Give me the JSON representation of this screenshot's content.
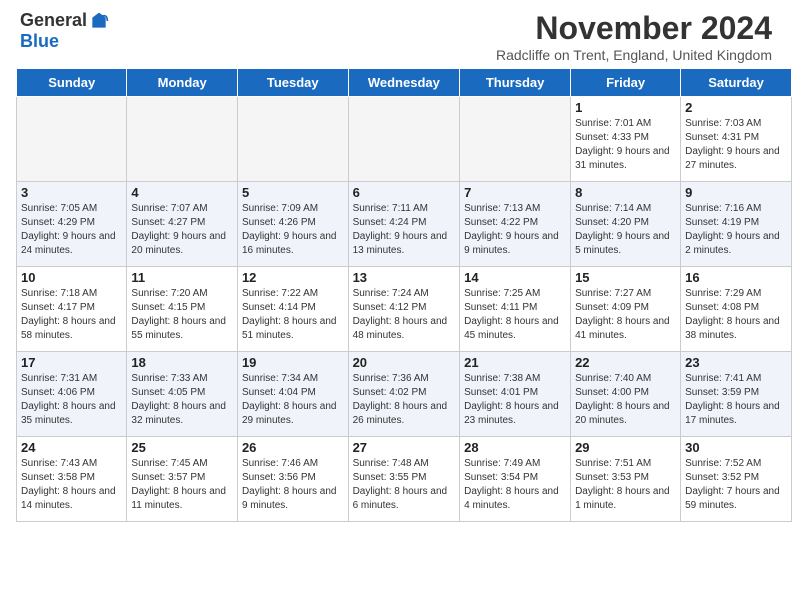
{
  "header": {
    "logo": {
      "general": "General",
      "blue": "Blue"
    },
    "title": "November 2024",
    "subtitle": "Radcliffe on Trent, England, United Kingdom"
  },
  "calendar": {
    "days_of_week": [
      "Sunday",
      "Monday",
      "Tuesday",
      "Wednesday",
      "Thursday",
      "Friday",
      "Saturday"
    ],
    "weeks": [
      [
        {
          "day": "",
          "info": ""
        },
        {
          "day": "",
          "info": ""
        },
        {
          "day": "",
          "info": ""
        },
        {
          "day": "",
          "info": ""
        },
        {
          "day": "",
          "info": ""
        },
        {
          "day": "1",
          "info": "Sunrise: 7:01 AM\nSunset: 4:33 PM\nDaylight: 9 hours and 31 minutes."
        },
        {
          "day": "2",
          "info": "Sunrise: 7:03 AM\nSunset: 4:31 PM\nDaylight: 9 hours and 27 minutes."
        }
      ],
      [
        {
          "day": "3",
          "info": "Sunrise: 7:05 AM\nSunset: 4:29 PM\nDaylight: 9 hours and 24 minutes."
        },
        {
          "day": "4",
          "info": "Sunrise: 7:07 AM\nSunset: 4:27 PM\nDaylight: 9 hours and 20 minutes."
        },
        {
          "day": "5",
          "info": "Sunrise: 7:09 AM\nSunset: 4:26 PM\nDaylight: 9 hours and 16 minutes."
        },
        {
          "day": "6",
          "info": "Sunrise: 7:11 AM\nSunset: 4:24 PM\nDaylight: 9 hours and 13 minutes."
        },
        {
          "day": "7",
          "info": "Sunrise: 7:13 AM\nSunset: 4:22 PM\nDaylight: 9 hours and 9 minutes."
        },
        {
          "day": "8",
          "info": "Sunrise: 7:14 AM\nSunset: 4:20 PM\nDaylight: 9 hours and 5 minutes."
        },
        {
          "day": "9",
          "info": "Sunrise: 7:16 AM\nSunset: 4:19 PM\nDaylight: 9 hours and 2 minutes."
        }
      ],
      [
        {
          "day": "10",
          "info": "Sunrise: 7:18 AM\nSunset: 4:17 PM\nDaylight: 8 hours and 58 minutes."
        },
        {
          "day": "11",
          "info": "Sunrise: 7:20 AM\nSunset: 4:15 PM\nDaylight: 8 hours and 55 minutes."
        },
        {
          "day": "12",
          "info": "Sunrise: 7:22 AM\nSunset: 4:14 PM\nDaylight: 8 hours and 51 minutes."
        },
        {
          "day": "13",
          "info": "Sunrise: 7:24 AM\nSunset: 4:12 PM\nDaylight: 8 hours and 48 minutes."
        },
        {
          "day": "14",
          "info": "Sunrise: 7:25 AM\nSunset: 4:11 PM\nDaylight: 8 hours and 45 minutes."
        },
        {
          "day": "15",
          "info": "Sunrise: 7:27 AM\nSunset: 4:09 PM\nDaylight: 8 hours and 41 minutes."
        },
        {
          "day": "16",
          "info": "Sunrise: 7:29 AM\nSunset: 4:08 PM\nDaylight: 8 hours and 38 minutes."
        }
      ],
      [
        {
          "day": "17",
          "info": "Sunrise: 7:31 AM\nSunset: 4:06 PM\nDaylight: 8 hours and 35 minutes."
        },
        {
          "day": "18",
          "info": "Sunrise: 7:33 AM\nSunset: 4:05 PM\nDaylight: 8 hours and 32 minutes."
        },
        {
          "day": "19",
          "info": "Sunrise: 7:34 AM\nSunset: 4:04 PM\nDaylight: 8 hours and 29 minutes."
        },
        {
          "day": "20",
          "info": "Sunrise: 7:36 AM\nSunset: 4:02 PM\nDaylight: 8 hours and 26 minutes."
        },
        {
          "day": "21",
          "info": "Sunrise: 7:38 AM\nSunset: 4:01 PM\nDaylight: 8 hours and 23 minutes."
        },
        {
          "day": "22",
          "info": "Sunrise: 7:40 AM\nSunset: 4:00 PM\nDaylight: 8 hours and 20 minutes."
        },
        {
          "day": "23",
          "info": "Sunrise: 7:41 AM\nSunset: 3:59 PM\nDaylight: 8 hours and 17 minutes."
        }
      ],
      [
        {
          "day": "24",
          "info": "Sunrise: 7:43 AM\nSunset: 3:58 PM\nDaylight: 8 hours and 14 minutes."
        },
        {
          "day": "25",
          "info": "Sunrise: 7:45 AM\nSunset: 3:57 PM\nDaylight: 8 hours and 11 minutes."
        },
        {
          "day": "26",
          "info": "Sunrise: 7:46 AM\nSunset: 3:56 PM\nDaylight: 8 hours and 9 minutes."
        },
        {
          "day": "27",
          "info": "Sunrise: 7:48 AM\nSunset: 3:55 PM\nDaylight: 8 hours and 6 minutes."
        },
        {
          "day": "28",
          "info": "Sunrise: 7:49 AM\nSunset: 3:54 PM\nDaylight: 8 hours and 4 minutes."
        },
        {
          "day": "29",
          "info": "Sunrise: 7:51 AM\nSunset: 3:53 PM\nDaylight: 8 hours and 1 minute."
        },
        {
          "day": "30",
          "info": "Sunrise: 7:52 AM\nSunset: 3:52 PM\nDaylight: 7 hours and 59 minutes."
        }
      ]
    ]
  }
}
